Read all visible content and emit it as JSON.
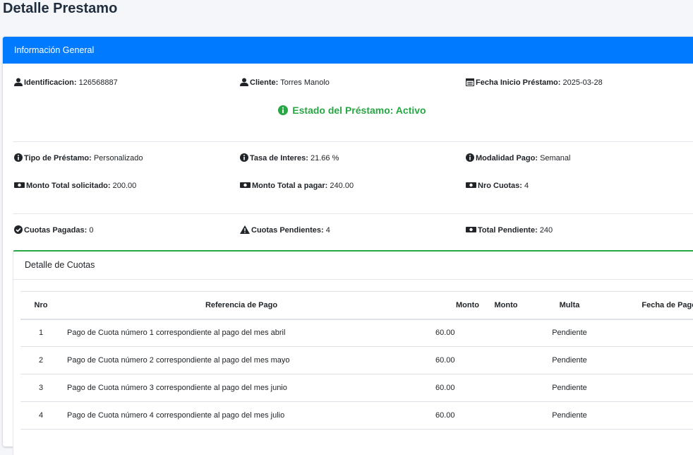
{
  "page": {
    "title": "Detalle Prestamo"
  },
  "card": {
    "header": "Información General"
  },
  "general": {
    "identificacion": {
      "label": "Identificacion:",
      "value": "126568887",
      "icon": "user-icon"
    },
    "cliente": {
      "label": "Cliente:",
      "value": "Torres Manolo",
      "icon": "user-icon"
    },
    "fecha_inicio": {
      "label": "Fecha Inicio Préstamo:",
      "value": "2025-03-28",
      "icon": "calendar-icon"
    },
    "estado": "Estado del Préstamo: Activo",
    "tipo": {
      "label": "Tipo de Préstamo:",
      "value": "Personalizado",
      "icon": "info-circle-icon"
    },
    "tasa": {
      "label": "Tasa de Interes:",
      "value": "21.66 %",
      "icon": "info-circle-icon"
    },
    "modalidad": {
      "label": "Modalidad Pago:",
      "value": "Semanal",
      "icon": "info-circle-icon"
    },
    "monto_solicitado": {
      "label": "Monto Total solicitado:",
      "value": "200.00",
      "icon": "money-bill-icon"
    },
    "monto_pagar": {
      "label": "Monto Total a pagar:",
      "value": "240.00",
      "icon": "money-bill-icon"
    },
    "nro_cuotas": {
      "label": "Nro Cuotas:",
      "value": "4",
      "icon": "money-bill-icon"
    },
    "cuotas_pagadas": {
      "label": "Cuotas Pagadas:",
      "value": "0",
      "icon": "check-circle-icon"
    },
    "cuotas_pendientes": {
      "label": "Cuotas Pendientes:",
      "value": "4",
      "icon": "warning-icon"
    },
    "total_pendiente": {
      "label": "Total Pendiente:",
      "value": "240",
      "icon": "money-bill-icon"
    }
  },
  "cuotas": {
    "title": "Detalle de Cuotas",
    "columns": [
      "Nro",
      "Referencia de Pago",
      "Monto",
      "Monto",
      "Multa",
      "Fecha de Pago"
    ],
    "rows": [
      {
        "nro": "1",
        "referencia": "Pago de Cuota número 1 correspondiente al pago del mes abril",
        "monto": "60.00",
        "multa": "Pendiente"
      },
      {
        "nro": "2",
        "referencia": "Pago de Cuota número 2 correspondiente al pago del mes mayo",
        "monto": "60.00",
        "multa": "Pendiente"
      },
      {
        "nro": "3",
        "referencia": "Pago de Cuota número 3 correspondiente al pago del mes junio",
        "monto": "60.00",
        "multa": "Pendiente"
      },
      {
        "nro": "4",
        "referencia": "Pago de Cuota número 4 correspondiente al pago del mes julio",
        "monto": "60.00",
        "multa": "Pendiente"
      }
    ]
  },
  "colors": {
    "primary": "#007bff",
    "success": "#28a745",
    "text": "#212529"
  }
}
